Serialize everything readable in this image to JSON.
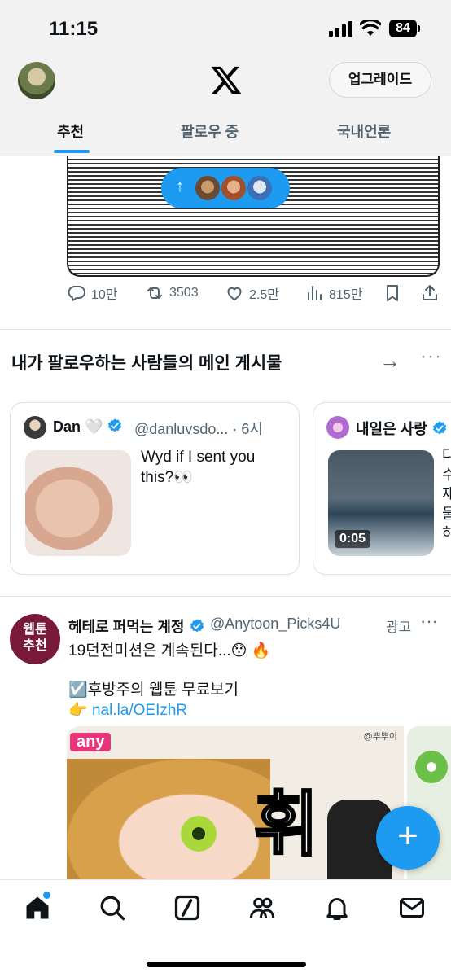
{
  "status_bar": {
    "time": "11:15",
    "battery": "84"
  },
  "header": {
    "upgrade_label": "업그레이드",
    "tabs": [
      {
        "label": "추천",
        "active": true
      },
      {
        "label": "팔로우 중",
        "active": false
      },
      {
        "label": "국내언론",
        "active": false
      }
    ]
  },
  "new_posts_pill": {
    "arrow": "↑"
  },
  "post_actions": {
    "replies": "10만",
    "reposts": "3503",
    "likes": "2.5만",
    "views": "815만"
  },
  "follow_section": {
    "title": "내가 팔로우하는 사람들의 메인 게시물",
    "arrow": "→",
    "more": "···",
    "cards": [
      {
        "name": "Dan",
        "emoji": "🤍",
        "handle": "@danluvsdo...",
        "time": "· 6시",
        "text": "Wyd if I sent you this?👀"
      },
      {
        "name": "내일은 사랑",
        "video_duration": "0:05",
        "text_lines": [
          "다",
          "수",
          "재",
          "물",
          "하"
        ]
      }
    ]
  },
  "ad_post": {
    "avatar_text_line1": "웹툰",
    "avatar_text_line2": "추천",
    "name": "헤테로 퍼먹는 계정",
    "handle": "@Anytoon_Picks4U",
    "ad_label": "광고",
    "more": "···",
    "line1": "19던전미션은 계속된다...😯 🔥",
    "line2": "☑️후방주의 웹툰 무료보기",
    "line3_prefix": "👉 ",
    "link": "nal.la/OEIzhR",
    "media_badge": "any",
    "media_sfx": "휘",
    "media_credit": "@뿌뿌이"
  },
  "fab": {
    "label": "+"
  },
  "colors": {
    "accent": "#1d9bf0",
    "text": "#0f1419",
    "muted": "#536471"
  },
  "icons": [
    "x-logo-icon",
    "reply-icon",
    "repost-icon",
    "like-icon",
    "views-icon",
    "bookmark-icon",
    "share-icon",
    "verified-icon",
    "home-icon",
    "search-icon",
    "grok-icon",
    "communities-icon",
    "notifications-icon",
    "messages-icon"
  ]
}
